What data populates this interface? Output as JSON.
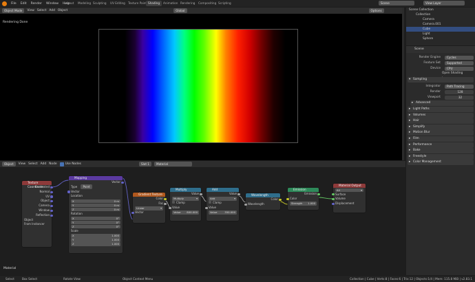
{
  "menu": {
    "items": [
      "File",
      "Edit",
      "Render",
      "Window",
      "Help"
    ],
    "workspaces": [
      "Layout",
      "Modeling",
      "Sculpting",
      "UV Editing",
      "Texture Paint",
      "Shading",
      "Animation",
      "Rendering",
      "Compositing",
      "Scripting"
    ],
    "active_workspace": "Shading",
    "scene": "Scene",
    "view_layer": "View Layer"
  },
  "viewport": {
    "mode": "Object Mode",
    "menus": [
      "View",
      "Select",
      "Add",
      "Object"
    ],
    "orientation": "Global",
    "status": "Rendering Done",
    "options": "Options"
  },
  "outliner": {
    "root": "Scene Collection",
    "collection": "Collection",
    "items": [
      "Camera",
      "Camera.001",
      "Cube",
      "Light",
      "Sphere"
    ]
  },
  "properties": {
    "scene": "Scene",
    "render_engine_label": "Render Engine",
    "render_engine": "Cycles",
    "feature_set_label": "Feature Set",
    "feature_set": "Supported",
    "device_label": "Device",
    "device": "CPU",
    "osl": "Open Shading Language",
    "sampling": "Sampling",
    "integrator_label": "Integrator",
    "integrator": "Path Tracing",
    "render_label": "Render",
    "render_samples": "128",
    "viewport_label": "Viewport",
    "viewport_samples": "32",
    "panels": [
      "Advanced",
      "Light Paths",
      "Volumes",
      "Hair",
      "Simplify",
      "Motion Blur",
      "Film",
      "Performance",
      "Bake",
      "Freestyle",
      "Color Management"
    ]
  },
  "node_header": {
    "editor": "Object",
    "menus": [
      "View",
      "Select",
      "Add",
      "Node"
    ],
    "use_nodes": "Use Nodes",
    "slot": "Slot 1",
    "material": "Material"
  },
  "nodes": {
    "tex_coord": {
      "title": "Texture Coordinate",
      "outputs": [
        "Generated",
        "Normal",
        "UV",
        "Object",
        "Camera",
        "Window",
        "Reflection"
      ],
      "object_label": "Object",
      "from_instancer": "From Instancer"
    },
    "mapping": {
      "title": "Mapping",
      "out": "Vector",
      "type_label": "Type",
      "type": "Point",
      "vector": "Vector",
      "location": "Location",
      "rotation": "Rotation",
      "scale": "Scale",
      "loc": [
        "0 m",
        "0 m",
        "0 m"
      ],
      "rot": [
        "0°",
        "0°",
        "0°"
      ],
      "scl": [
        "1.000",
        "1.000",
        "1.000"
      ],
      "axes": [
        "X",
        "Y",
        "Z"
      ]
    },
    "gradient": {
      "title": "Gradient Texture",
      "outputs": [
        "Color",
        "Fac"
      ],
      "type": "Linear",
      "input": "Vector"
    },
    "math1": {
      "title": "Multiply",
      "out": "Value",
      "op": "Multiply",
      "clamp": "Clamp",
      "value_label": "Value",
      "value": "800.000"
    },
    "math2": {
      "title": "Add",
      "out": "Value",
      "op": "Add",
      "clamp": "Clamp",
      "value_label": "Value",
      "value": "350.000"
    },
    "wavelength": {
      "title": "Wavelength",
      "out": "Color",
      "input": "Wavelength"
    },
    "emission": {
      "title": "Emission",
      "out": "Emission",
      "color": "Color",
      "strength_label": "Strength",
      "strength": "1.000"
    },
    "output": {
      "title": "Material Output",
      "target": "All",
      "inputs": [
        "Surface",
        "Volume",
        "Displacement"
      ]
    }
  },
  "node_footer": "Material",
  "statusbar": {
    "select": "Select",
    "box_select": "Box Select",
    "rotate": "Rotate View",
    "context_menu": "Object Context Menu",
    "stats": "Collection | Cube | Verts:8 | Faces:6 | Tris:12 | Objects:1/4 | Mem: 115.8 MiB | v2.83.1"
  },
  "colors": {
    "accent": "#4772b3",
    "orange": "#e87d0d"
  }
}
